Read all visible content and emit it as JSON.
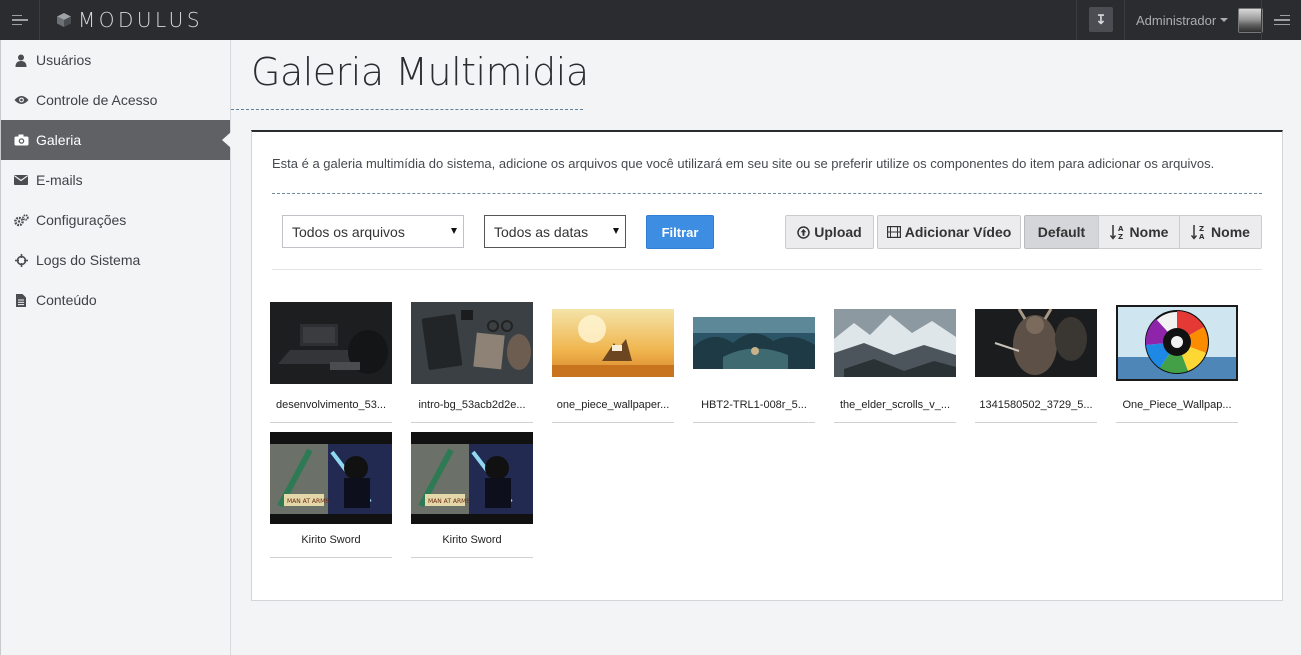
{
  "topbar": {
    "brand": "MODULUS",
    "notify_icon": "↧",
    "user_name": "Administrador"
  },
  "sidebar": {
    "items": [
      {
        "label": "Usuários",
        "icon": "user-icon"
      },
      {
        "label": "Controle de Acesso",
        "icon": "eye-icon"
      },
      {
        "label": "Galeria",
        "icon": "camera-icon",
        "active": true
      },
      {
        "label": "E-mails",
        "icon": "envelope-icon"
      },
      {
        "label": "Configurações",
        "icon": "gears-icon"
      },
      {
        "label": "Logs do Sistema",
        "icon": "crosshair-icon"
      },
      {
        "label": "Conteúdo",
        "icon": "file-icon"
      }
    ]
  },
  "main": {
    "title": "Galeria Multimidia",
    "intro": "Esta é a galeria multimídia do sistema, adicione os arquivos que você utilizará em  seu site  ou se preferir utilize os componentes do item para adicionar os arquivos.",
    "filters": {
      "type_select": "Todos os arquivos",
      "date_select": "Todos as datas",
      "filter_button": "Filtrar"
    },
    "toolbar": {
      "upload": "Upload",
      "add_video": "Adicionar Vídeo",
      "default": "Default",
      "name_asc": "Nome",
      "name_desc": "Nome"
    },
    "gallery": [
      {
        "caption": "desenvolvimento_53..."
      },
      {
        "caption": "intro-bg_53acb2d2e..."
      },
      {
        "caption": "one_piece_wallpaper..."
      },
      {
        "caption": "HBT2-TRL1-008r_5..."
      },
      {
        "caption": "the_elder_scrolls_v_..."
      },
      {
        "caption": "1341580502_3729_5..."
      },
      {
        "caption": "One_Piece_Wallpap..."
      },
      {
        "caption": "Kirito Sword"
      },
      {
        "caption": "Kirito Sword"
      }
    ]
  },
  "colors": {
    "topbar": "#2b2c30",
    "sidebar_active": "#5f6165",
    "primary_button": "#3d8ee3"
  }
}
